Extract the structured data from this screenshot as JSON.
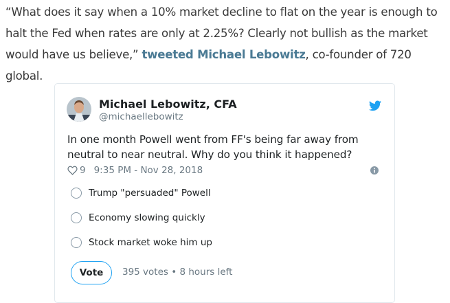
{
  "article": {
    "quote": "“What does it say when a 10% market decline to flat on the year is enough to halt the Fed when rates are only at 2.25%? Clearly not bullish as the market would have us believe,”",
    "link_text": "tweeted Michael Lebowitz",
    "suffix": ", co-founder of 720 global."
  },
  "tweet": {
    "author_name": "Michael Lebowitz, CFA",
    "author_handle": "@michaellebowitz",
    "text": "In one month Powell went from FF's being far away from neutral to near neutral. Why do you think it happened?",
    "likes": "9",
    "timestamp": "9:35 PM - Nov 28, 2018",
    "poll": {
      "options": [
        "Trump \"persuaded\" Powell",
        "Economy slowing quickly",
        "Stock market woke him up"
      ],
      "vote_label": "Vote",
      "status": "395 votes • 8 hours left"
    }
  },
  "colors": {
    "link": "#4a7a94",
    "twitter_blue": "#1da1f2",
    "muted": "#697882"
  },
  "icons": [
    "twitter-bird-icon",
    "heart-icon",
    "info-icon",
    "avatar"
  ]
}
